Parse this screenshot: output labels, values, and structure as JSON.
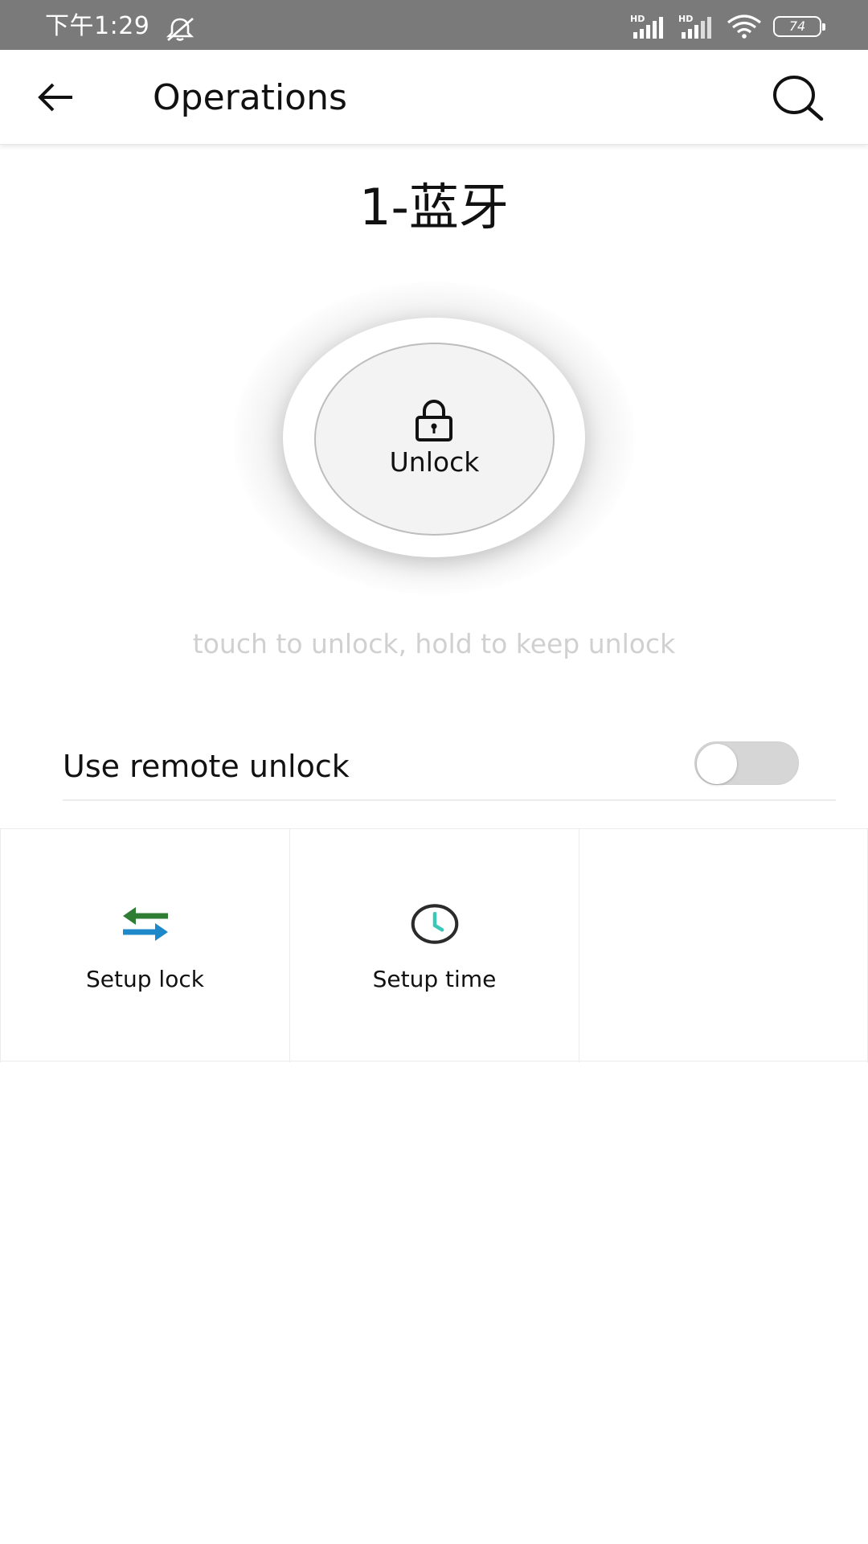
{
  "status_bar": {
    "time": "下午1:29",
    "signal_label_1": "HD",
    "signal_label_2": "HD",
    "battery": "74",
    "icons": [
      "dnd-bell-off-icon",
      "signal-icon",
      "signal-icon",
      "wifi-icon",
      "battery-icon"
    ]
  },
  "app_bar": {
    "title": "Operations",
    "back_icon": "arrow-left-icon",
    "search_icon": "search-icon"
  },
  "lock": {
    "name": "1-蓝牙",
    "unlock_label": "Unlock",
    "unlock_icon": "padlock-icon",
    "hint": "touch to unlock, hold to keep unlock"
  },
  "remote_unlock": {
    "label": "Use remote unlock",
    "enabled": false
  },
  "actions": [
    {
      "label": "Setup lock",
      "icon": "swap-arrows-icon"
    },
    {
      "label": "Setup time",
      "icon": "clock-icon"
    },
    {
      "label": "",
      "icon": ""
    }
  ],
  "colors": {
    "status_bar_bg": "#7a7a7a",
    "swap_green": "#2e7d32",
    "swap_blue": "#1e88c9",
    "clock_hand": "#3cc7b8",
    "hint_text": "#d0d0d0"
  }
}
